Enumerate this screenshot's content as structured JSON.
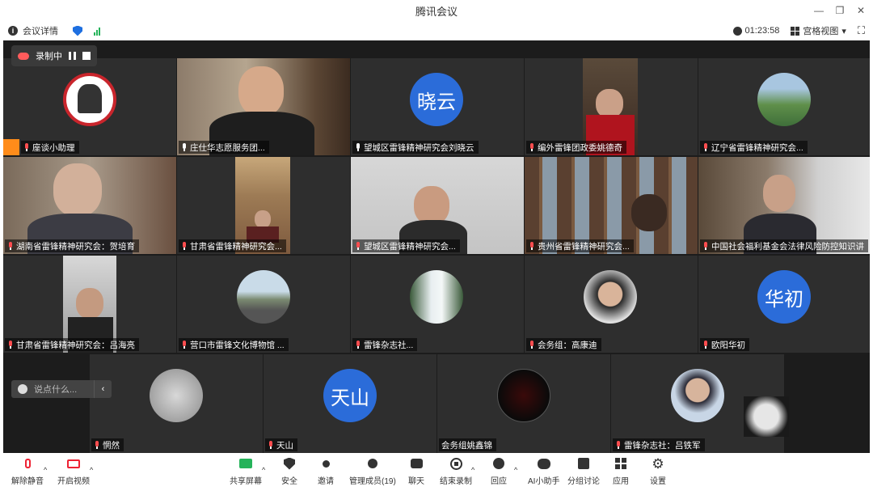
{
  "window": {
    "title": "腾讯会议",
    "minimize": "—",
    "restore": "❐",
    "close": "✕"
  },
  "infobar": {
    "meeting_details": "会议详情",
    "timer": "01:23:58",
    "view_mode": "宫格视图"
  },
  "recording": {
    "label": "录制中"
  },
  "chat": {
    "placeholder": "说点什么..."
  },
  "participants": [
    {
      "name": "座谈小助理"
    },
    {
      "name": "庄仕华志愿服务团..."
    },
    {
      "name": "望城区雷锋精神研究会刘晓云",
      "avatar_text": "晓云"
    },
    {
      "name": "编外雷锋团政委姚德奇"
    },
    {
      "name": "辽宁省雷锋精神研究会..."
    },
    {
      "name": "湖南省雷锋精神研究会：贺培育"
    },
    {
      "name": "甘肃省雷锋精神研究会..."
    },
    {
      "name": "望城区雷锋精神研究会..."
    },
    {
      "name": "贵州省雷锋精神研究会..."
    },
    {
      "name": "中国社会福利基金会法律风险防控知识讲"
    },
    {
      "name": "甘肃省雷锋精神研究会：吕海亮"
    },
    {
      "name": "营口市雷锋文化博物馆 ..."
    },
    {
      "name": "雷锋杂志社..."
    },
    {
      "name": "会务组：高康迪"
    },
    {
      "name": "欧阳华初",
      "avatar_text": "华初"
    },
    {
      "name": "惘然"
    },
    {
      "name": "天山",
      "avatar_text": "天山"
    },
    {
      "name": "会务组姚鑫锦"
    },
    {
      "name": "雷锋杂志社：吕铁军"
    }
  ],
  "toolbar": {
    "unmute": "解除静音",
    "start_video": "开启视频",
    "share_screen": "共享屏幕",
    "security": "安全",
    "invite": "邀请",
    "manage_members": "管理成员(19)",
    "chat": "聊天",
    "end_recording": "结束录制",
    "replay": "回应",
    "ai_assistant": "AI小助手",
    "breakout": "分组讨论",
    "apps": "应用",
    "settings": "设置"
  },
  "colors": {
    "accent": "#2b6cd9",
    "active_border": "#2fbf5b",
    "muted_mic": "#ff4d4f",
    "recording": "#ff5b5b"
  }
}
